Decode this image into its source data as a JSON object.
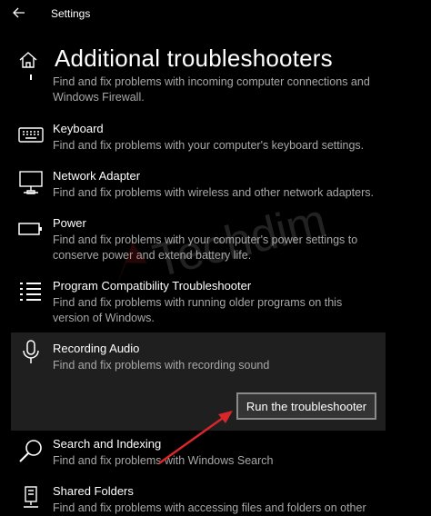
{
  "window": {
    "title": "Settings"
  },
  "page": {
    "title": "Additional troubleshooters"
  },
  "items": [
    {
      "name": "",
      "description": "Find and fix problems with incoming computer connections and Windows Firewall.",
      "icon": "firewall-icon"
    },
    {
      "name": "Keyboard",
      "description": "Find and fix problems with your computer's keyboard settings.",
      "icon": "keyboard-icon"
    },
    {
      "name": "Network Adapter",
      "description": "Find and fix problems with wireless and other network adapters.",
      "icon": "network-adapter-icon"
    },
    {
      "name": "Power",
      "description": "Find and fix problems with your computer's power settings to conserve power and extend battery life.",
      "icon": "battery-icon"
    },
    {
      "name": "Program Compatibility Troubleshooter",
      "description": "Find and fix problems with running older programs on this version of Windows.",
      "icon": "list-icon"
    },
    {
      "name": "Recording Audio",
      "description": "Find and fix problems with recording sound",
      "icon": "microphone-icon",
      "action": "Run the troubleshooter"
    },
    {
      "name": "Search and Indexing",
      "description": "Find and fix problems with Windows Search",
      "icon": "search-icon"
    },
    {
      "name": "Shared Folders",
      "description": "Find and fix problems with accessing files and folders on other",
      "icon": "shared-folder-icon"
    }
  ],
  "watermark": {
    "text": "Techdim"
  },
  "colors": {
    "background": "#000000",
    "selected": "#1f1f1f",
    "description": "#a8a8a8",
    "arrow": "#d9262a"
  }
}
